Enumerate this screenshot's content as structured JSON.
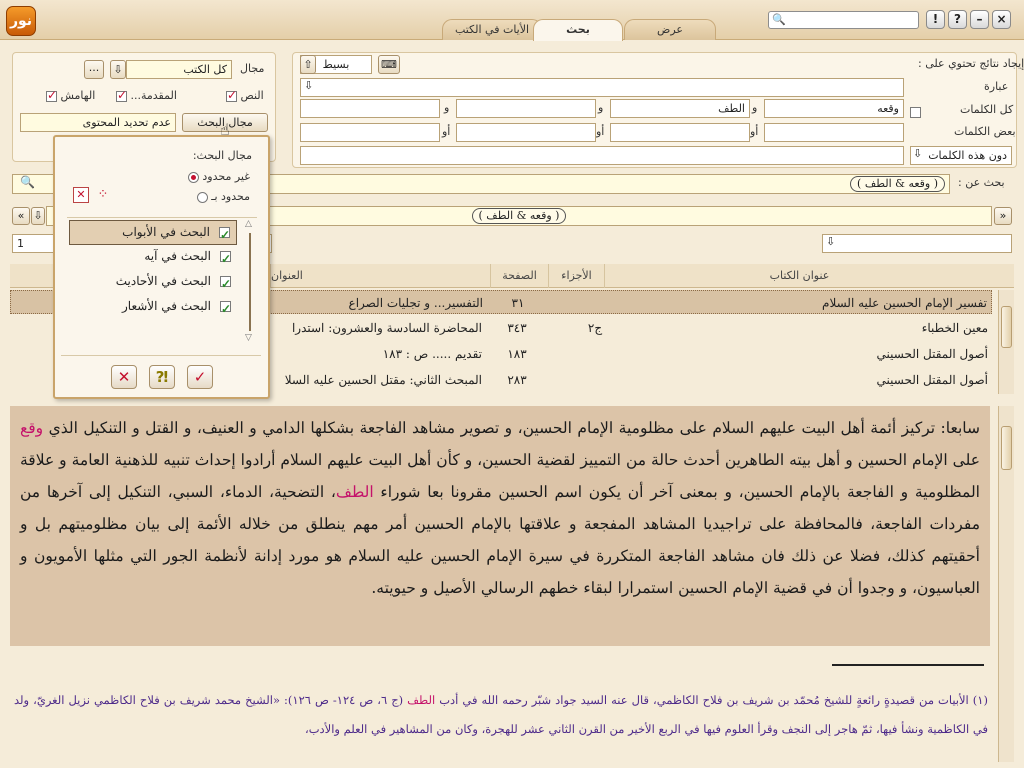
{
  "app": {
    "logo_text": "نور"
  },
  "tabs": [
    {
      "label": "الأيات في الكتب",
      "active": false
    },
    {
      "label": "بحث",
      "active": true
    },
    {
      "label": "عرض",
      "active": false
    }
  ],
  "window_buttons": [
    "!",
    "?",
    "–",
    "×"
  ],
  "search_panel": {
    "find_label": "إيجاد نتائج تحتوي على :",
    "mode_value": "بسيط",
    "phrase_label": "عبارة",
    "all_words_label": "كل الكلمات",
    "some_words_label": "بعض الكلمات",
    "without_label": "دون هذه الكلمات",
    "and_word": "و",
    "or_word": "أو",
    "all_words": [
      "وقعه",
      "الطف",
      "",
      ""
    ],
    "search_in_label": "بحث عن :",
    "search_in_value": "( وقعه & الطف )"
  },
  "scope_panel": {
    "field_label": "مجال",
    "field_value": "كل الكتب",
    "more_button": "...",
    "text_label": "النص",
    "intro_label": "المقدمة...",
    "margin_label": "الهامش",
    "scope_button": "مجال البحث",
    "scope_value": "عدم تحديد المحتوى"
  },
  "popup": {
    "title": "مجال البحث:",
    "unlimited": "غير محدود",
    "limited": "محدود بـ",
    "items": [
      {
        "label": "البحث في الأبواب",
        "checked": true
      },
      {
        "label": "البحث في آيه",
        "checked": true
      },
      {
        "label": "البحث في الأحاديث",
        "checked": true
      },
      {
        "label": "البحث في الأشعار",
        "checked": true
      }
    ]
  },
  "results_bar": {
    "query": "( وقعه & الطف )",
    "page_value": "1"
  },
  "table": {
    "headers": [
      "عنوان الكتاب",
      "الأجزاء",
      "الصفحة",
      "العنوان"
    ],
    "rows": [
      {
        "book": "تفسير الإمام الحسين عليه السلام",
        "part": "",
        "page": "٣١",
        "title": "التفسير... و تجليات الصراع"
      },
      {
        "book": "معين الخطباء",
        "part": "ج٢",
        "page": "٣٤٣",
        "title": "المحاضرة السادسة والعشرون: استدرا"
      },
      {
        "book": "أصول المقتل الحسيني",
        "part": "",
        "page": "١٨٣",
        "title": "تقديم ..... ص : ١٨٣"
      },
      {
        "book": "أصول المقتل الحسيني",
        "part": "",
        "page": "٢٨٣",
        "title": "المبحث الثاني: مقتل الحسين عليه السلا"
      }
    ]
  },
  "content": {
    "p1": "سابعا: تركيز أئمة أهل البيت عليهم السلام على مظلومية الإمام الحسين، و تصوير مشاهد الفاجعة بشكلها الدامي و العنيف، و القتل و التنكيل الذي ",
    "hl1": "وقع",
    "p2": " على الإمام الحسين و أهل بيته الطاهرين أحدث حالة من التمييز لقضية الحسين، و كأن أهل البيت عليهم السلام أرادوا إحداث تنبيه للذهنية العامة و علاقة المظلومية و الفاجعة بالإمام الحسين، و بمعنى آخر أن يكون اسم الحسين مقرونا بعا شوراء ",
    "hl2": "الطف",
    "p3": "، التضحية، الدماء، السبي، التنكيل إلى آخرها من مفردات الفاجعة، فالمحافظة على تراجيديا المشاهد المفجعة و علاقتها بالإمام الحسين أمر مهم ينطلق من خلاله الأئمة إلى بيان مظلوميتهم بل و أحقيتهم كذلك، فضلا عن ذلك فان مشاهد الفاجعة المتكررة في سيرة الإمام الحسين عليه السلام هو مورد إدانة لأنظمة الجور التي مثلها الأمويون و العباسيون، و وجدوا أن في قضية الإمام الحسين استمرارا لبقاء خطهم الرسالي الأصيل و حيويته."
  },
  "footnote": {
    "f1": "(١) الأبيات من قصيدةٍ رائعةٍ للشيخ مُحمّد بن شريف بن فلاح الكاظمي، قال عنه السيد جواد شبّر رحمه الله في أدب ",
    "hl": "الطف",
    "f2": " (ج ٦، ص ١٢٤- ص ١٢٦): «الشيخ محمد شريف بن فلاح الكاظمي نزيل الغريّ، ولد في الكاظمية ونشأ فيها، ثمّ هاجر إلى النجف وقرأ العلوم فيها في الربع الأخير من القرن الثاني عشر للهجرة، وكان من المشاهير في العلم والأدب،"
  },
  "colors": {
    "accent": "#c4112f",
    "highlight": "#c4116a",
    "content_bg": "#dcc4a8",
    "footnote": "#4d2a8a"
  }
}
